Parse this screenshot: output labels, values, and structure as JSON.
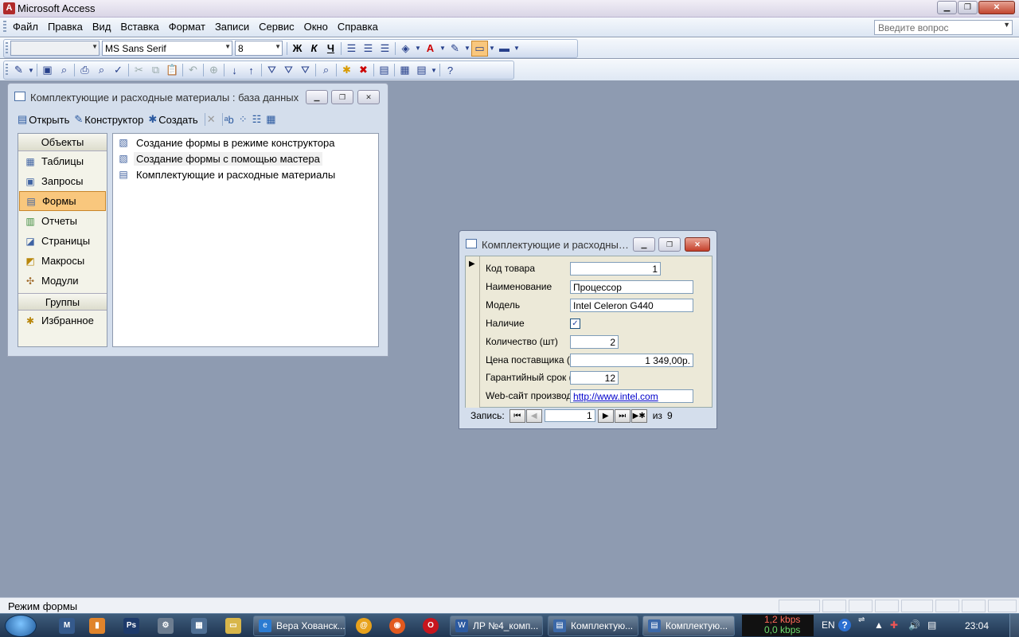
{
  "app": {
    "title": "Microsoft Access"
  },
  "menu": {
    "items": [
      "Файл",
      "Правка",
      "Вид",
      "Вставка",
      "Формат",
      "Записи",
      "Сервис",
      "Окно",
      "Справка"
    ],
    "question_placeholder": "Введите вопрос"
  },
  "format_toolbar": {
    "object_value": "",
    "font_name": "MS Sans Serif",
    "font_size": "8",
    "bold": "Ж",
    "italic": "К",
    "underline": "Ч"
  },
  "db_window": {
    "title": "Комплектующие и расходные материалы : база данных (фо...",
    "tools": {
      "open": "Открыть",
      "design": "Конструктор",
      "create": "Создать"
    },
    "objects_header": "Объекты",
    "objects": [
      {
        "label": "Таблицы",
        "icon": "table-icon"
      },
      {
        "label": "Запросы",
        "icon": "query-icon"
      },
      {
        "label": "Формы",
        "icon": "form-icon",
        "selected": true
      },
      {
        "label": "Отчеты",
        "icon": "report-icon"
      },
      {
        "label": "Страницы",
        "icon": "page-icon"
      },
      {
        "label": "Макросы",
        "icon": "macro-icon"
      },
      {
        "label": "Модули",
        "icon": "module-icon"
      }
    ],
    "groups_header": "Группы",
    "groups": [
      {
        "label": "Избранное",
        "icon": "favorites-icon"
      }
    ],
    "list": [
      "Создание формы в режиме конструктора",
      "Создание формы с помощью мастера",
      "Комплектующие и расходные материалы"
    ]
  },
  "form_window": {
    "title": "Комплектующие и расходные ...",
    "fields": [
      {
        "label": "Код товара",
        "value": "1"
      },
      {
        "label": "Наименование",
        "value": "Процессор"
      },
      {
        "label": "Модель",
        "value": "Intel Celeron G440"
      },
      {
        "label": "Наличие",
        "checked": true
      },
      {
        "label": "Количество (шт)",
        "value": "2"
      },
      {
        "label": "Цена поставщика (р",
        "value": "1 349,00р."
      },
      {
        "label": "Гарантийный срок (",
        "value": "12"
      },
      {
        "label": "Web-сайт производ",
        "value": "http://www.intel.com"
      }
    ],
    "nav": {
      "label": "Запись:",
      "current": "1",
      "of": "из",
      "total": "9"
    }
  },
  "status": {
    "text": "Режим формы"
  },
  "taskbar": {
    "tasks": [
      "Вера Хованск...",
      "ЛР №4_комп...",
      "Комплектую...",
      "Комплектую..."
    ],
    "net_down": "1,2 kbps",
    "net_up": "0,0 kbps",
    "lang": "EN",
    "clock": "23:04"
  },
  "colors": {
    "selected_bg": "#f9c77d",
    "link": "#0000cc",
    "desktop": "#8e9bb1"
  }
}
